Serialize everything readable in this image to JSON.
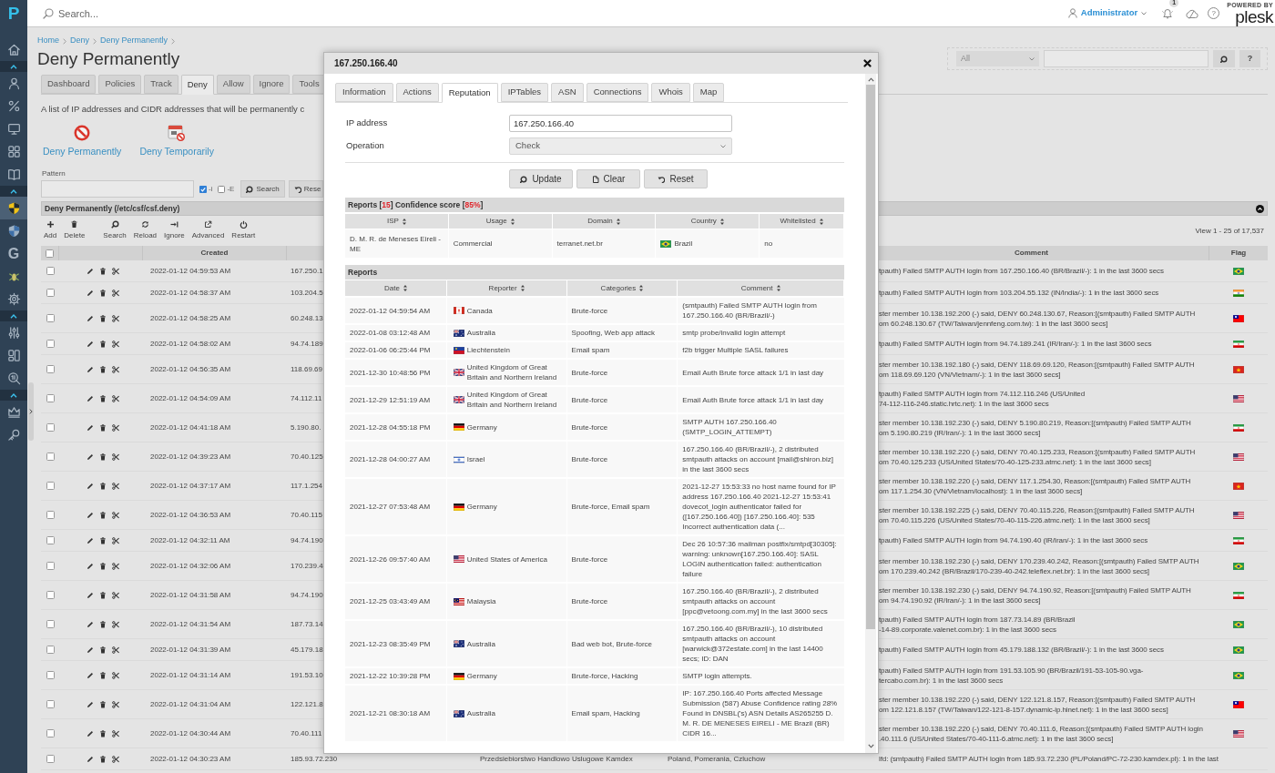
{
  "sidebar": {
    "logo": "P",
    "groups": [
      {
        "items": [
          {
            "selected": false
          }
        ]
      },
      {
        "expanded": true,
        "items": [
          {
            "selected": false
          },
          {
            "selected": false
          },
          {
            "selected": false
          },
          {
            "selected": false
          },
          {
            "selected": false
          }
        ]
      },
      {
        "expanded": true,
        "items": [
          {
            "selected": true
          },
          {
            "selected": false
          },
          {
            "selected": false,
            "glyph": "G"
          },
          {
            "selected": false
          },
          {
            "selected": false
          }
        ]
      },
      {
        "expanded": true,
        "items": [
          {
            "selected": false
          },
          {
            "selected": false
          },
          {
            "selected": false
          }
        ]
      },
      {
        "expanded": true,
        "items": [
          {
            "selected": false
          },
          {
            "selected": false
          }
        ]
      }
    ]
  },
  "topbar": {
    "search": {
      "placeholder": "Search..."
    },
    "user": "Administrator",
    "notifications": "1",
    "help": "?",
    "logo_caption": "POWERED BY",
    "logo": "plesk"
  },
  "page": {
    "breadcrumbs": [
      "Home",
      "Deny",
      "Deny Permanently"
    ],
    "title": "Deny Permanently",
    "filter": {
      "scope": "All",
      "help": "?"
    },
    "tabs": [
      {
        "label": "Dashboard",
        "selected": false
      },
      {
        "label": "Policies",
        "selected": false
      },
      {
        "label": "Track",
        "selected": false
      },
      {
        "label": "Deny",
        "selected": true
      },
      {
        "label": "Allow",
        "selected": false
      },
      {
        "label": "Ignore",
        "selected": false
      },
      {
        "label": "Tools",
        "selected": false
      }
    ],
    "description": "A list of IP addresses and CIDR addresses that will be permanently c",
    "quick_actions": [
      "Deny Permanently",
      "Deny Temporarily"
    ],
    "pattern": {
      "label": "Pattern",
      "options": [
        {
          "label": "-i",
          "checked": true
        },
        {
          "label": "-E",
          "checked": false
        }
      ],
      "buttons": [
        "Search",
        "Rese"
      ]
    },
    "panel": {
      "title": "Deny Permanently (/etc/csf/csf.deny)",
      "expanded": true,
      "toolbar": [
        "Add",
        "Delete",
        "Search",
        "Reload",
        "Ignore",
        "Advanced",
        "Restart"
      ],
      "pager": "View 1 - 25 of 17,537",
      "all_checked": false,
      "columns": {
        "created": "Created",
        "comment": "Comment",
        "flag": "Flag"
      },
      "rows": [
        {
          "checked": false,
          "created": "2022-01-12 04:59:53 AM",
          "ip": "167.250.1",
          "comment_lines": [
            "tpauth) Failed SMTP AUTH login from 167.250.166.40 (BR/Brazil/-): 1 in the last 3600 secs"
          ],
          "kind": "brazil"
        },
        {
          "checked": false,
          "created": "2022-01-12 04:58:37 AM",
          "ip": "103.204.5",
          "comment_lines": [
            "tpauth) Failed SMTP AUTH login from 103.204.55.132 (IN/India/-): 1 in the last 3600 secs"
          ],
          "kind": "india"
        },
        {
          "checked": false,
          "created": "2022-01-12 04:58:25 AM",
          "ip": "60.248.13",
          "comment_lines": [
            "ster member 10.138.192.200 (-) said, DENY 60.248.130.67, Reason:[(smtpauth) Failed SMTP AUTH",
            "om 60.248.130.67 (TW/Taiwan/jennfeng.com.tw): 1 in the last 3600 secs]"
          ],
          "kind": "taiwan"
        },
        {
          "checked": false,
          "created": "2022-01-12 04:58:02 AM",
          "ip": "94.74.189",
          "comment_lines": [
            "tpauth) Failed SMTP AUTH login from 94.74.189.241 (IR/Iran/-): 1 in the last 3600 secs"
          ],
          "kind": "iran"
        },
        {
          "checked": false,
          "created": "2022-01-12 04:56:35 AM",
          "ip": "118.69.69",
          "comment_lines": [
            "ster member 10.138.192.180 (-) said, DENY 118.69.69.120, Reason:[(smtpauth) Failed SMTP AUTH",
            "om 118.69.69.120 (VN/Vietnam/-): 1 in the last 3600 secs]"
          ],
          "kind": "vietnam"
        },
        {
          "checked": false,
          "created": "2022-01-12 04:54:09 AM",
          "ip": "74.112.11",
          "comment_lines": [
            "tpauth) Failed SMTP AUTH login from 74.112.116.246 (US/United",
            "74-112-116-246.static.hrtc.net): 1 in the last 3600 secs"
          ],
          "kind": "usa"
        },
        {
          "checked": false,
          "created": "2022-01-12 04:41:18 AM",
          "ip": "5.190.80.",
          "comment_lines": [
            "ster member 10.138.192.230 (-) said, DENY 5.190.80.219, Reason:[(smtpauth) Failed SMTP AUTH",
            "om 5.190.80.219 (IR/Iran/-): 1 in the last 3600 secs]"
          ],
          "kind": "iran"
        },
        {
          "checked": false,
          "created": "2022-01-12 04:39:23 AM",
          "ip": "70.40.125",
          "comment_lines": [
            "ster member 10.138.192.220 (-) said, DENY 70.40.125.233, Reason:[(smtpauth) Failed SMTP AUTH",
            "om 70.40.125.233 (US/United States/70-40-125-233.atmc.net): 1 in the last 3600 secs]"
          ],
          "kind": "usa"
        },
        {
          "checked": false,
          "created": "2022-01-12 04:37:17 AM",
          "ip": "117.1.254",
          "comment_lines": [
            "ster member 10.138.192.220 (-) said, DENY 117.1.254.30, Reason:[(smtpauth) Failed SMTP AUTH",
            "om 117.1.254.30 (VN/Vietnam/localhost): 1 in the last 3600 secs]"
          ],
          "kind": "vietnam"
        },
        {
          "checked": false,
          "created": "2022-01-12 04:36:53 AM",
          "ip": "70.40.115",
          "comment_lines": [
            "ster member 10.138.192.225 (-) said, DENY 70.40.115.226, Reason:[(smtpauth) Failed SMTP AUTH",
            "om 70.40.115.226 (US/United States/70-40-115-226.atmc.net): 1 in the last 3600 secs]"
          ],
          "kind": "usa"
        },
        {
          "checked": false,
          "created": "2022-01-12 04:32:11 AM",
          "ip": "94.74.190",
          "comment_lines": [
            "tpauth) Failed SMTP AUTH login from 94.74.190.40 (IR/Iran/-): 1 in the last 3600 secs"
          ],
          "kind": "iran"
        },
        {
          "checked": false,
          "created": "2022-01-12 04:32:06 AM",
          "ip": "170.239.4",
          "comment_lines": [
            "ster member 10.138.192.230 (-) said, DENY 170.239.40.242, Reason:[(smtpauth) Failed SMTP AUTH",
            "om 170.239.40.242 (BR/Brazil/170-239-40-242.teleflex.net.br): 1 in the last 3600 secs]"
          ],
          "kind": "brazil"
        },
        {
          "checked": false,
          "created": "2022-01-12 04:31:58 AM",
          "ip": "94.74.190",
          "comment_lines": [
            "ster member 10.138.192.230 (-) said, DENY 94.74.190.92, Reason:[(smtpauth) Failed SMTP AUTH",
            "om 94.74.190.92 (IR/Iran/-): 1 in the last 3600 secs]"
          ],
          "kind": "iran"
        },
        {
          "checked": false,
          "created": "2022-01-12 04:31:54 AM",
          "ip": "187.73.14",
          "comment_lines": [
            "tpauth) Failed SMTP AUTH login from 187.73.14.89 (BR/Brazil",
            "-14-89.corporate.valenet.com.br): 1 in the last 3600 secs"
          ],
          "kind": "brazil"
        },
        {
          "checked": false,
          "created": "2022-01-12 04:31:39 AM",
          "ip": "45.179.18",
          "comment_lines": [
            "tpauth) Failed SMTP AUTH login from 45.179.188.132 (BR/Brazil/-): 1 in the last 3600 secs"
          ],
          "kind": "brazil"
        },
        {
          "checked": false,
          "created": "2022-01-12 04:31:14 AM",
          "ip": "191.53.10",
          "comment_lines": [
            "tpauth) Failed SMTP AUTH login from 191.53.105.90 (BR/Brazil/191-53-105-90.vga-",
            "tercabo.com.br): 1 in the last 3600 secs"
          ],
          "kind": "brazil"
        },
        {
          "checked": false,
          "created": "2022-01-12 04:31:04 AM",
          "ip": "122.121.8",
          "comment_lines": [
            "ster member 10.138.192.220 (-) said, DENY 122.121.8.157, Reason:[(smtpauth) Failed SMTP AUTH",
            "om 122.121.8.157 (TW/Taiwan/122-121-8-157.dynamic-ip.hinet.net): 1 in the last 3600 secs]"
          ],
          "kind": "taiwan"
        },
        {
          "checked": false,
          "created": "2022-01-12 04:30:44 AM",
          "ip": "70.40.111",
          "comment_lines": [
            "ster member 10.138.192.220 (-) said, DENY 70.40.111.6, Reason:[(smtpauth) Failed SMTP AUTH login",
            ".40.111.6 (US/United States/70-40-111-6.atmc.net): 1 in the last 3600 secs]"
          ],
          "kind": "usa"
        },
        {
          "checked": false,
          "created": "2022-01-12 04:30:23 AM",
          "ip": "185.93.72.230",
          "isp": "Przedsiebiorstwo Handlowo Uslugowe Kamdex",
          "location": "Poland, Pomerania, Czluchow",
          "comment_lines": [
            "lfd: (smtpauth) Failed SMTP AUTH login from 185.93.72.230 (PL/Poland/PC-72-230.kamdex.pl): 1 in the last"
          ]
        }
      ]
    }
  },
  "dialog": {
    "title": "167.250.166.40",
    "tabs": [
      {
        "label": "Information",
        "selected": false
      },
      {
        "label": "Actions",
        "selected": false
      },
      {
        "label": "Reputation",
        "selected": true
      },
      {
        "label": "IPTables",
        "selected": false
      },
      {
        "label": "ASN",
        "selected": false
      },
      {
        "label": "Connections",
        "selected": false
      },
      {
        "label": "Whois",
        "selected": false
      },
      {
        "label": "Map",
        "selected": false
      }
    ],
    "fields": [
      {
        "kind": "input",
        "label": "IP address",
        "value": "167.250.166.40"
      },
      {
        "kind": "select",
        "label": "Operation",
        "value": "Check"
      }
    ],
    "buttons": [
      "Update",
      "Clear",
      "Reset"
    ],
    "summary": [
      {
        "text": "Reports [",
        "alert": false
      },
      {
        "text": "15",
        "alert": true
      },
      {
        "text": "] Confidence score [",
        "alert": false
      },
      {
        "text": "85%",
        "alert": true
      },
      {
        "text": "]",
        "alert": false
      }
    ],
    "ip_info": {
      "columns": [
        "ISP",
        "Usage",
        "Domain",
        "Country",
        "Whitelisted"
      ],
      "rows": [
        {
          "isp": "D. M. R. de Meneses Eireli - ME",
          "usage": "Commercial",
          "domain": "terranet.net.br",
          "kind": "brazil",
          "country": "Brazil",
          "whitelisted": "no"
        }
      ]
    },
    "reports": {
      "title": "Reports",
      "columns": [
        "Date",
        "Reporter",
        "Categories",
        "Comment"
      ],
      "rows": [
        {
          "date": "2022-01-12 04:59:54 AM",
          "kind": "canada",
          "reporter": "Canada",
          "categories": "Brute-force",
          "comment": "(smtpauth) Failed SMTP AUTH login from 167.250.166.40 (BR/Brazil/-)"
        },
        {
          "date": "2022-01-08 03:12:48 AM",
          "kind": "australia",
          "reporter": "Australia",
          "categories": "Spoofing, Web app attack",
          "comment": "smtp probe/invalid login attempt"
        },
        {
          "date": "2022-01-06 06:25:44 PM",
          "kind": "liechtenstein",
          "reporter": "Liechtenstein",
          "categories": "Email spam",
          "comment": "f2b trigger Multiple SASL failures"
        },
        {
          "date": "2021-12-30 10:48:56 PM",
          "kind": "uk",
          "reporter": "United Kingdom of Great Britain and Northern Ireland",
          "categories": "Brute-force",
          "comment": "Email Auth Brute force attack 1/1 in last day"
        },
        {
          "date": "2021-12-29 12:51:19 AM",
          "kind": "uk",
          "reporter": "United Kingdom of Great Britain and Northern Ireland",
          "categories": "Brute-force",
          "comment": "Email Auth Brute force attack 1/1 in last day"
        },
        {
          "date": "2021-12-28 04:55:18 PM",
          "kind": "germany",
          "reporter": "Germany",
          "categories": "Brute-force",
          "comment": "SMTP AUTH 167.250.166.40 (SMTP_LOGIN_ATTEMPT)"
        },
        {
          "date": "2021-12-28 04:00:27 AM",
          "kind": "israel",
          "reporter": "Israel",
          "categories": "Brute-force",
          "comment": "167.250.166.40 (BR/Brazil/-), 2 distributed smtpauth attacks on account [mail@shiron.biz] in the last 3600 secs"
        },
        {
          "date": "2021-12-27 07:53:48 AM",
          "kind": "germany",
          "reporter": "Germany",
          "categories": "Brute-force, Email spam",
          "comment": "2021-12-27 15:53:33 no host name found for IP address 167.250.166.40 2021-12-27 15:53:41 dovecot_login authenticator failed for ([167.250.166.40]) [167.250.166.40]: 535 Incorrect authentication data (..."
        },
        {
          "date": "2021-12-26 09:57:40 AM",
          "kind": "usa",
          "reporter": "United States of America",
          "categories": "Brute-force",
          "comment": "Dec 26 10:57:36 mailman postfix/smtpd[30305]: warning: unknown[167.250.166.40]: SASL LOGIN authentication failed: authentication failure"
        },
        {
          "date": "2021-12-25 03:43:49 AM",
          "kind": "malaysia",
          "reporter": "Malaysia",
          "categories": "Brute-force",
          "comment": "167.250.166.40 (BR/Brazil/-), 2 distributed smtpauth attacks on account [ppc@vetoong.com.my] in the last 3600 secs"
        },
        {
          "date": "2021-12-23 08:35:49 PM",
          "kind": "australia",
          "reporter": "Australia",
          "categories": "Bad web bot, Brute-force",
          "comment": "167.250.166.40 (BR/Brazil/-), 10 distributed smtpauth attacks on account [warwick@372estate.com] in the last 14400 secs; ID: DAN"
        },
        {
          "date": "2021-12-22 10:39:28 PM",
          "kind": "germany",
          "reporter": "Germany",
          "categories": "Brute-force, Hacking",
          "comment": "SMTP login attempts."
        },
        {
          "date": "2021-12-21 08:30:18 AM",
          "kind": "australia",
          "reporter": "Australia",
          "categories": "Email spam, Hacking",
          "comment": "IP: 167.250.166.40 Ports affected Message Submission (587) Abuse Confidence rating 28% Found in DNSBL('s) ASN Details AS265255 D. M. R. DE MENESES EIRELI - ME Brazil (BR) CIDR 16..."
        }
      ]
    }
  }
}
